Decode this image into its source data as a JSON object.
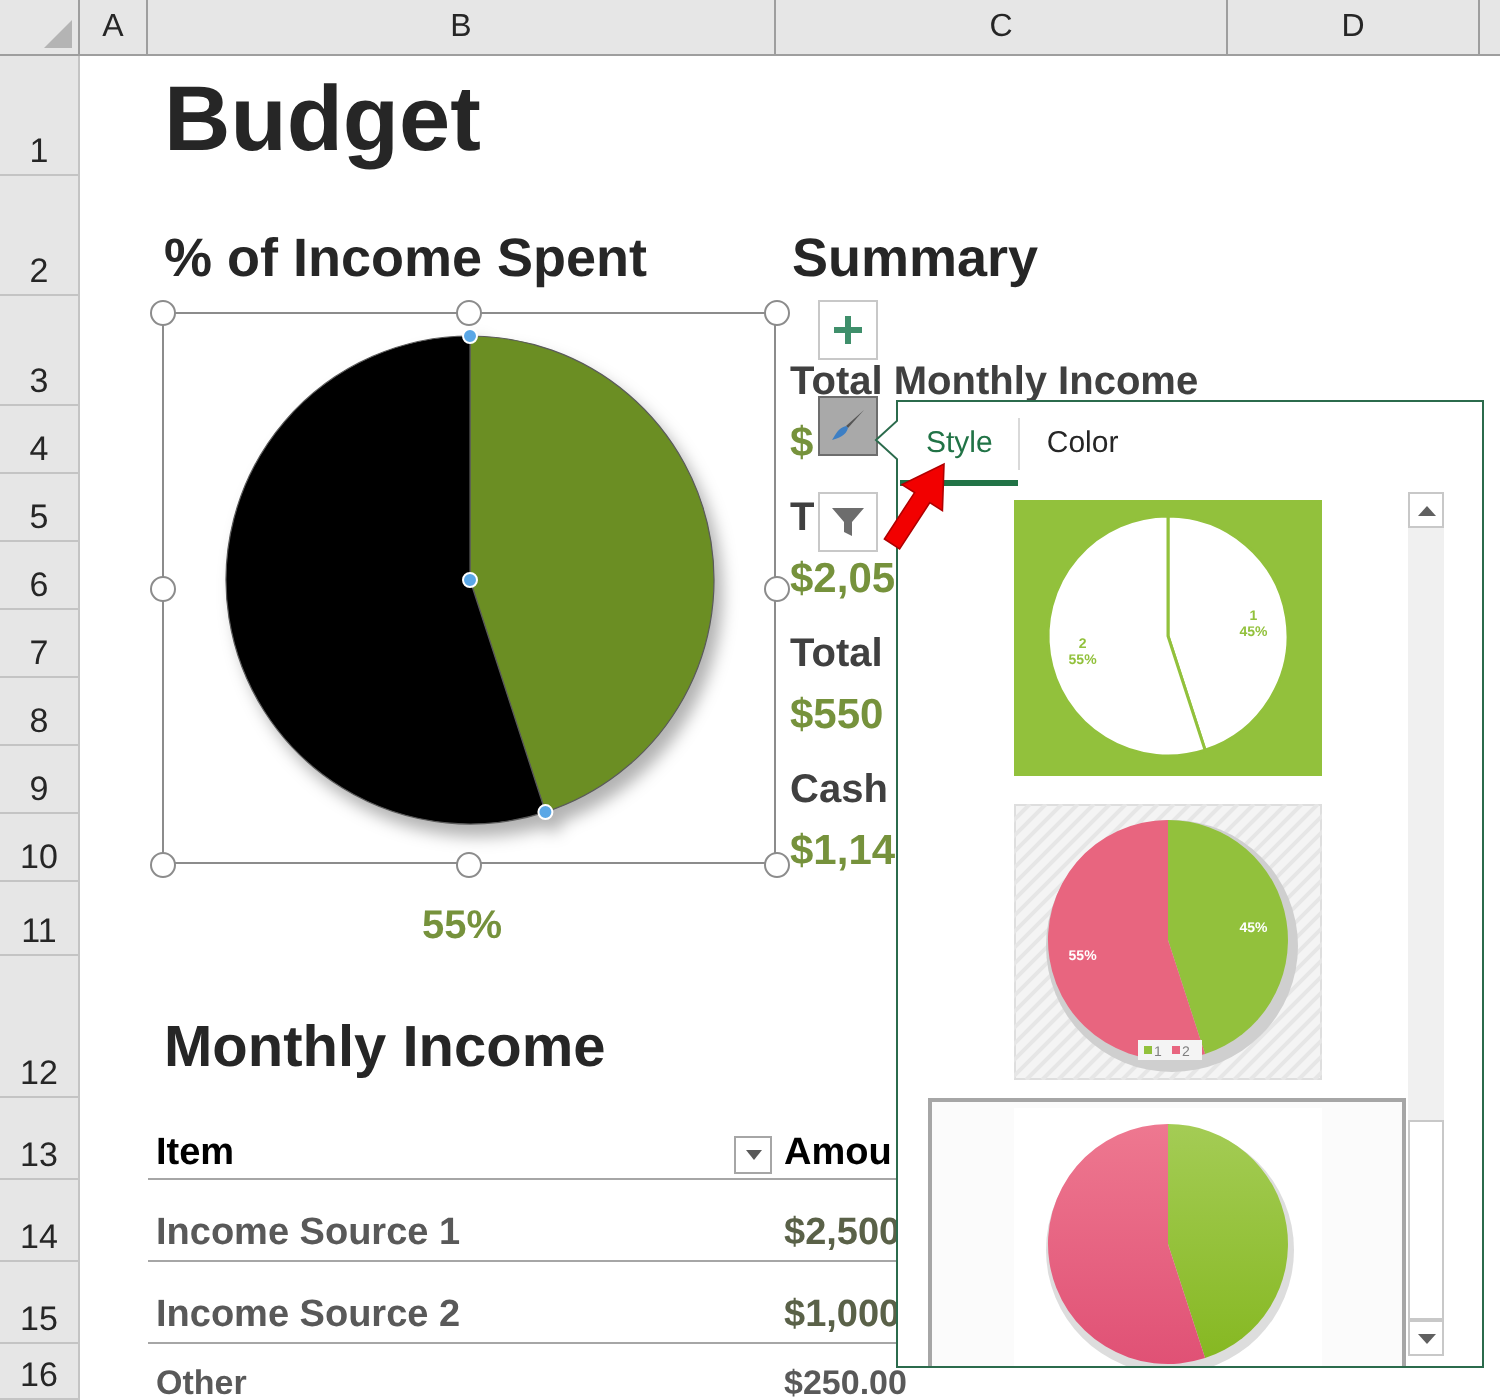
{
  "columns": [
    "A",
    "B",
    "C",
    "D"
  ],
  "rows": [
    {
      "number": "1",
      "col_b": {
        "kind": "title",
        "text": "Budget"
      }
    },
    {
      "number": "2",
      "col_b": {
        "kind": "heading",
        "text": "% of Income Spent"
      },
      "col_c": {
        "kind": "heading",
        "text": "Summary"
      }
    },
    {
      "number": "3",
      "col_c": {
        "kind": "label",
        "text": "Total Monthly Income"
      }
    },
    {
      "number": "4",
      "col_c": {
        "kind": "amount",
        "text": "$"
      }
    },
    {
      "number": "5",
      "col_c": {
        "kind": "label",
        "text": "T"
      }
    },
    {
      "number": "6",
      "col_c": {
        "kind": "amount",
        "text": "$2,05"
      }
    },
    {
      "number": "7",
      "col_c": {
        "kind": "label",
        "text": "Total"
      }
    },
    {
      "number": "8",
      "col_c": {
        "kind": "amount",
        "text": "$550"
      }
    },
    {
      "number": "9",
      "col_c": {
        "kind": "label",
        "text": "Cash"
      }
    },
    {
      "number": "10",
      "col_c": {
        "kind": "amount",
        "text": "$1,14"
      }
    },
    {
      "number": "11",
      "col_b": {
        "kind": "percent",
        "text": "55%"
      }
    },
    {
      "number": "12",
      "col_b": {
        "kind": "section",
        "text": "Monthly Income"
      }
    },
    {
      "number": "13",
      "col_b": {
        "kind": "table-header",
        "text": "Item",
        "filter": true
      },
      "col_c": {
        "kind": "table-header",
        "text": "Amou"
      }
    },
    {
      "number": "14",
      "col_b": {
        "kind": "table-item",
        "text": "Income Source 1"
      },
      "col_c": {
        "kind": "table-amount",
        "text": "$2,500"
      }
    },
    {
      "number": "15",
      "col_b": {
        "kind": "table-item",
        "text": "Income Source 2"
      },
      "col_c": {
        "kind": "table-amount",
        "text": "$1,000"
      }
    },
    {
      "number": "16",
      "col_b": {
        "kind": "table-last",
        "text": "Other"
      },
      "col_c": {
        "kind": "table-last",
        "text": "$250.00"
      }
    }
  ],
  "chart": {
    "chart_data": {
      "type": "pie",
      "series": [
        {
          "values": [
            45,
            55
          ]
        }
      ]
    }
  },
  "chart_buttons": [
    {
      "kind": "add",
      "selected": false
    },
    {
      "kind": "brush",
      "selected": true
    },
    {
      "kind": "filter",
      "selected": false
    }
  ],
  "style_panel": {
    "tabs": [
      {
        "label": "Style",
        "selected": true
      },
      {
        "label": "Color",
        "selected": false
      }
    ],
    "styles": [
      {
        "kind": "flat",
        "selected": false,
        "slice_labels": [
          [
            "1",
            "45%"
          ],
          [
            "2",
            "55%"
          ]
        ]
      },
      {
        "kind": "shadow",
        "selected": false,
        "slice_labels": [
          [
            "45%"
          ],
          [
            "55%"
          ]
        ],
        "legend": [
          "1",
          "2"
        ]
      },
      {
        "kind": "gradient",
        "selected": true
      }
    ]
  }
}
